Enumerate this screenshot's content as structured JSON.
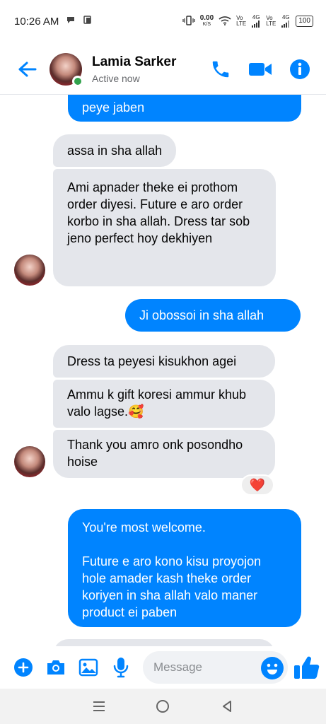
{
  "status_bar": {
    "time": "10:26 AM",
    "net_speed_value": "0.00",
    "net_speed_unit": "K/S",
    "sim1": "Vo\nLTE",
    "sim1_net": "4G",
    "sim2": "Vo\nLTE",
    "sim2_net": "4G",
    "battery": "100"
  },
  "header": {
    "contact_name": "Lamia Sarker",
    "contact_status": "Active now"
  },
  "messages": {
    "m0": "peye jaben",
    "m1": "assa in sha allah",
    "m2": "Ami apnader theke ei prothom order diyesi. Future e aro order korbo in sha allah. Dress tar sob jeno perfect hoy dekhiyen",
    "m3": "Ji obossoi in sha allah",
    "m4": "Dress ta peyesi kisukhon agei",
    "m5": "Ammu k gift koresi ammur khub valo lagse.🥰",
    "m6": "Thank you amro onk posondho hoise",
    "m6_reaction": "❤️",
    "m7_line1": "You're most welcome.",
    "m7_line2": "Future e aro kono kisu proyojon hole amader kash theke order koriyen in sha allah valo maner product ei paben"
  },
  "composer": {
    "placeholder": "Message"
  },
  "colors": {
    "accent": "#0084ff",
    "incoming_bubble": "#e4e6eb",
    "online": "#31a24c"
  }
}
